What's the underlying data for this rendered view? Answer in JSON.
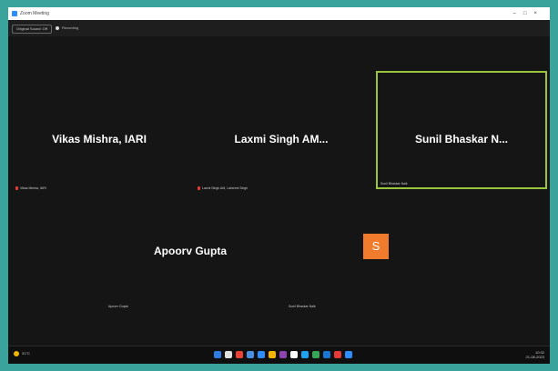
{
  "window": {
    "title": "Zoom Meeting"
  },
  "toolbar": {
    "view_label": "Original Sound: Off",
    "recording_label": "Recording"
  },
  "participants": [
    {
      "display": "Vikas Mishra, IARI",
      "label": "Vikas Mishra, IARI",
      "muted": true
    },
    {
      "display": "Laxmi Singh AM...",
      "label": "Laxmi Singh AM, Lakshmi Singh",
      "muted": true
    },
    {
      "display": "Sunil Bhaskar N...",
      "label": "Sunil Bhaskar Naik",
      "active": true
    },
    {
      "display": "Apoorv Gupta",
      "label": "Apoorv Gupta"
    },
    {
      "display": "",
      "label": "Sunil Bhaskar Naik",
      "avatar_letter": "S"
    }
  ],
  "taskbar": {
    "weather": "31°C",
    "icon_colors": [
      "#2d7be5",
      "#e0e0e0",
      "#ea4335",
      "#4a90e2",
      "#2d8cff",
      "#f4b400",
      "#8e44ad",
      "#ffffff",
      "#1da1f2",
      "#34a853",
      "#1976d2",
      "#e53935",
      "#2d8cff"
    ],
    "time": "10:32",
    "date": "21-08-2023"
  },
  "colors": {
    "active_border": "#9ac43d",
    "avatar": "#f07b2d",
    "frame": "#3aa39b"
  }
}
